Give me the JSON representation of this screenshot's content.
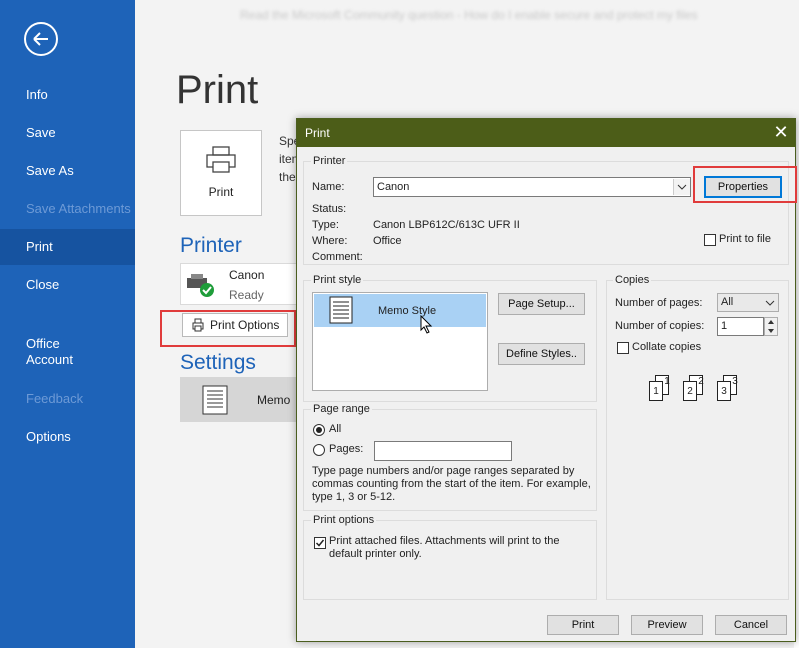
{
  "window": {
    "title_bar_text": "Read the Microsoft Community question - How do I enable secure and protect my files"
  },
  "sidebar": {
    "items": [
      {
        "label": "Info"
      },
      {
        "label": "Save"
      },
      {
        "label": "Save As"
      },
      {
        "label": "Save Attachments"
      },
      {
        "label": "Print"
      },
      {
        "label": "Close"
      },
      {
        "label": "Office\nAccount"
      },
      {
        "label": "Feedback"
      },
      {
        "label": "Options"
      }
    ]
  },
  "main": {
    "title": "Print",
    "print_button_label": "Print",
    "specify_text": "Specify item the",
    "printer_heading": "Printer",
    "printer_name": "Canon",
    "printer_status": "Ready",
    "print_options_label": "Print Options",
    "settings_heading": "Settings",
    "settings_style": "Memo"
  },
  "dialog": {
    "title": "Print",
    "close_glyph": "✕",
    "printer": {
      "heading": "Printer",
      "name_label": "Name:",
      "name_value": "Canon",
      "properties_label": "Properties",
      "status_label": "Status:",
      "type_label": "Type:",
      "type_value": "Canon LBP612C/613C UFR II",
      "where_label": "Where:",
      "where_value": "Office",
      "comment_label": "Comment:",
      "print_to_file_label": "Print to file"
    },
    "print_style": {
      "heading": "Print style",
      "selected": "Memo Style",
      "page_setup_label": "Page Setup...",
      "define_styles_label": "Define Styles.."
    },
    "copies": {
      "heading": "Copies",
      "pages_label": "Number of pages:",
      "pages_value": "All",
      "copies_label": "Number of copies:",
      "copies_value": "1",
      "collate_label": "Collate copies",
      "collate_numbers": [
        "1",
        "1",
        "2",
        "2",
        "3",
        "3"
      ]
    },
    "page_range": {
      "heading": "Page range",
      "all_label": "All",
      "pages_label": "Pages:",
      "pages_value": "",
      "help_text": "Type page numbers and/or page ranges separated by commas counting from the start of the item.  For example, type 1, 3 or 5-12."
    },
    "print_options": {
      "heading": "Print options",
      "attached_label": "Print attached files.  Attachments will print to the default printer only."
    },
    "buttons": {
      "print": "Print",
      "preview": "Preview",
      "cancel": "Cancel"
    }
  },
  "colors": {
    "sidebar_bg": "#1e63b8",
    "dialog_title_bg": "#4c5d18",
    "highlight_red": "#e03b3b",
    "selection_blue": "#a9d1f4"
  }
}
